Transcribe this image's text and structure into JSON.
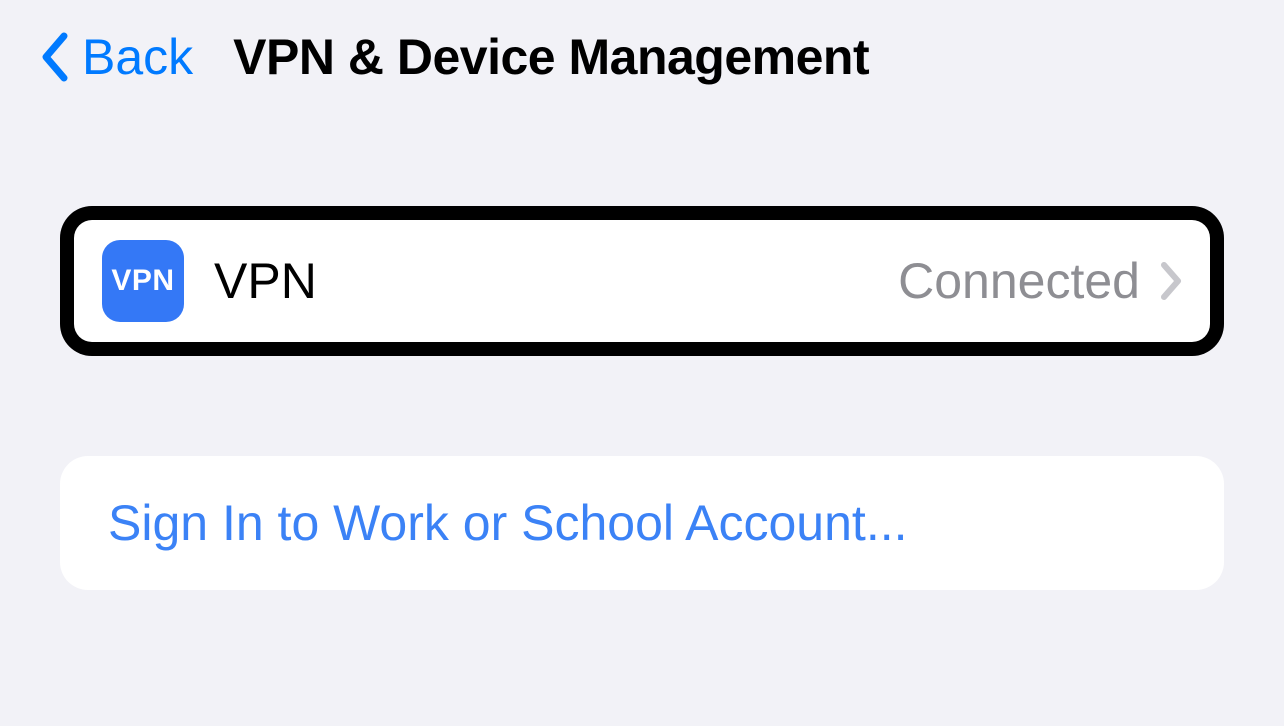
{
  "header": {
    "back_label": "Back",
    "title": "VPN & Device Management"
  },
  "vpn": {
    "icon_text": "VPN",
    "label": "VPN",
    "status": "Connected"
  },
  "signin": {
    "label": "Sign In to Work or School Account..."
  }
}
